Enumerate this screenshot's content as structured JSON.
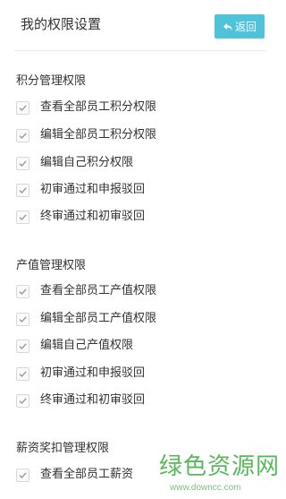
{
  "header": {
    "title": "我的权限设置",
    "back_label": "返回"
  },
  "sections": [
    {
      "title": "积分管理权限",
      "items": [
        {
          "label": "查看全部员工积分权限",
          "checked": true
        },
        {
          "label": "编辑全部员工积分权限",
          "checked": true
        },
        {
          "label": "编辑自己积分权限",
          "checked": true
        },
        {
          "label": "初审通过和申报驳回",
          "checked": true
        },
        {
          "label": "终审通过和初审驳回",
          "checked": true
        }
      ]
    },
    {
      "title": "产值管理权限",
      "items": [
        {
          "label": "查看全部员工产值权限",
          "checked": true
        },
        {
          "label": "编辑全部员工产值权限",
          "checked": true
        },
        {
          "label": "编辑自己产值权限",
          "checked": true
        },
        {
          "label": "初审通过和申报驳回",
          "checked": true
        },
        {
          "label": "终审通过和初审驳回",
          "checked": true
        }
      ]
    },
    {
      "title": "薪资奖扣管理权限",
      "items": [
        {
          "label": "查看全部员工薪资",
          "checked": true
        }
      ]
    }
  ],
  "watermark": {
    "text": "绿色资源网",
    "url": "www.downcc.com"
  },
  "colors": {
    "accent": "#4fc3d9",
    "check": "#9a9a9a",
    "watermark": "#59b85c"
  },
  "icons": {
    "back": "back-arrow-icon",
    "check": "check-icon"
  }
}
